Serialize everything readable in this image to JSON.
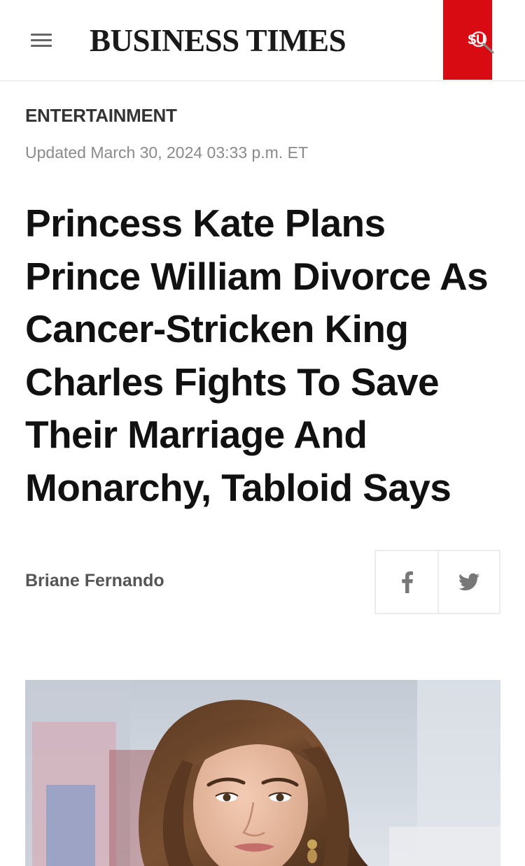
{
  "header": {
    "logo": "BUSINESS TIMES",
    "search_label": "SU",
    "accent_color": "#d80b12",
    "menu_icon": "hamburger-menu-icon",
    "search_icon": "magnifier-icon"
  },
  "article": {
    "section": "ENTERTAINMENT",
    "updated": "Updated March 30, 2024 03:33 p.m. ET",
    "headline": "Princess Kate Plans Prince William Divorce As Cancer-Stricken King Charles Fights To Save Their Marriage And Monarchy, Tabloid Says",
    "author": "Briane Fernando"
  },
  "share": {
    "facebook_icon": "facebook-icon",
    "twitter_icon": "twitter-icon"
  }
}
